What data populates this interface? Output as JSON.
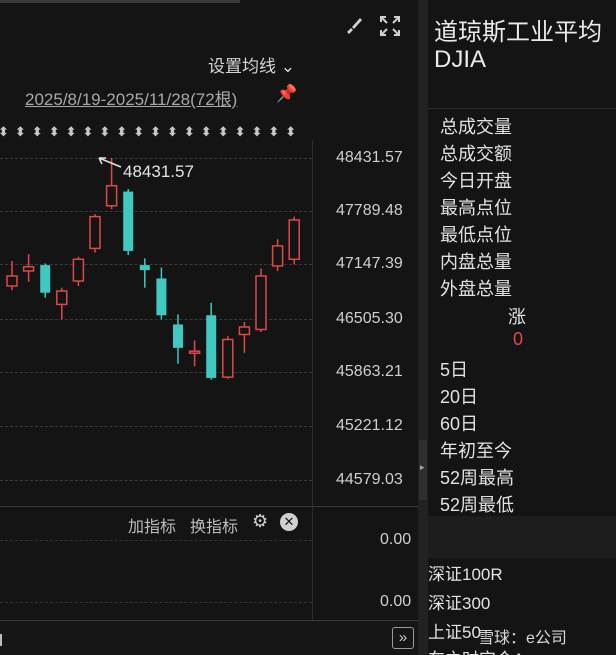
{
  "toolbar": {
    "brush_icon": "brush-icon",
    "fullscreen_icon": "fullscreen-icon"
  },
  "ma_setting_label": "设置均线",
  "date_range": "2025/8/19-2025/11/28(72根)",
  "price_axis": [
    "48431.57",
    "47789.48",
    "47147.39",
    "46505.30",
    "45863.21",
    "45221.12",
    "44579.03"
  ],
  "max_marker_label": "48431.57",
  "chart_data": {
    "type": "candlestick",
    "candles": [
      {
        "open": 46900,
        "close": 47020,
        "high": 47200,
        "low": 46850,
        "dir": "up"
      },
      {
        "open": 47130,
        "close": 47080,
        "high": 47280,
        "low": 46950,
        "dir": "up"
      },
      {
        "open": 47150,
        "close": 46820,
        "high": 47170,
        "low": 46760,
        "dir": "down"
      },
      {
        "open": 46680,
        "close": 46840,
        "high": 46880,
        "low": 46500,
        "dir": "up"
      },
      {
        "open": 46960,
        "close": 47220,
        "high": 47250,
        "low": 46900,
        "dir": "up"
      },
      {
        "open": 47350,
        "close": 47730,
        "high": 47760,
        "low": 47300,
        "dir": "up"
      },
      {
        "open": 47860,
        "close": 48100,
        "high": 48431.57,
        "low": 47820,
        "dir": "up"
      },
      {
        "open": 48030,
        "close": 47320,
        "high": 48060,
        "low": 47270,
        "dir": "down"
      },
      {
        "open": 47150,
        "close": 47090,
        "high": 47230,
        "low": 46880,
        "dir": "down"
      },
      {
        "open": 46990,
        "close": 46550,
        "high": 47120,
        "low": 46500,
        "dir": "down"
      },
      {
        "open": 46440,
        "close": 46160,
        "high": 46560,
        "low": 45970,
        "dir": "down"
      },
      {
        "open": 46120,
        "close": 46110,
        "high": 46250,
        "low": 45940,
        "dir": "up"
      },
      {
        "open": 46550,
        "close": 45800,
        "high": 46700,
        "low": 45780,
        "dir": "down"
      },
      {
        "open": 45810,
        "close": 46260,
        "high": 46300,
        "low": 45790,
        "dir": "up"
      },
      {
        "open": 46320,
        "close": 46410,
        "high": 46470,
        "low": 46100,
        "dir": "up"
      },
      {
        "open": 46380,
        "close": 47020,
        "high": 47110,
        "low": 46350,
        "dir": "up"
      },
      {
        "open": 47140,
        "close": 47380,
        "high": 47460,
        "low": 47080,
        "dir": "up"
      },
      {
        "open": 47220,
        "close": 47690,
        "high": 47730,
        "low": 47160,
        "dir": "up"
      }
    ],
    "colors": {
      "up": "#e04848",
      "down": "#3fc9c1"
    }
  },
  "sub_panel": {
    "add_indicator": "加指标",
    "switch_indicator": "换指标",
    "value_top": "0.00",
    "value_bottom": "0.00"
  },
  "info": {
    "index_name": "道琼斯工业平均",
    "index_code": "DJIA",
    "stats": [
      "总成交量",
      "总成交额",
      "今日开盘",
      "最高点位",
      "最低点位",
      "内盘总量",
      "外盘总量"
    ],
    "zhang_label": "涨",
    "zhang_value": "0",
    "periods": [
      "5日",
      "20日",
      "60日",
      "年初至今",
      "52周最高",
      "52周最低"
    ],
    "related": [
      "深证100R",
      "深证300",
      "上证50",
      "车之时宝合A"
    ]
  },
  "watermark": "雪球：e公司"
}
